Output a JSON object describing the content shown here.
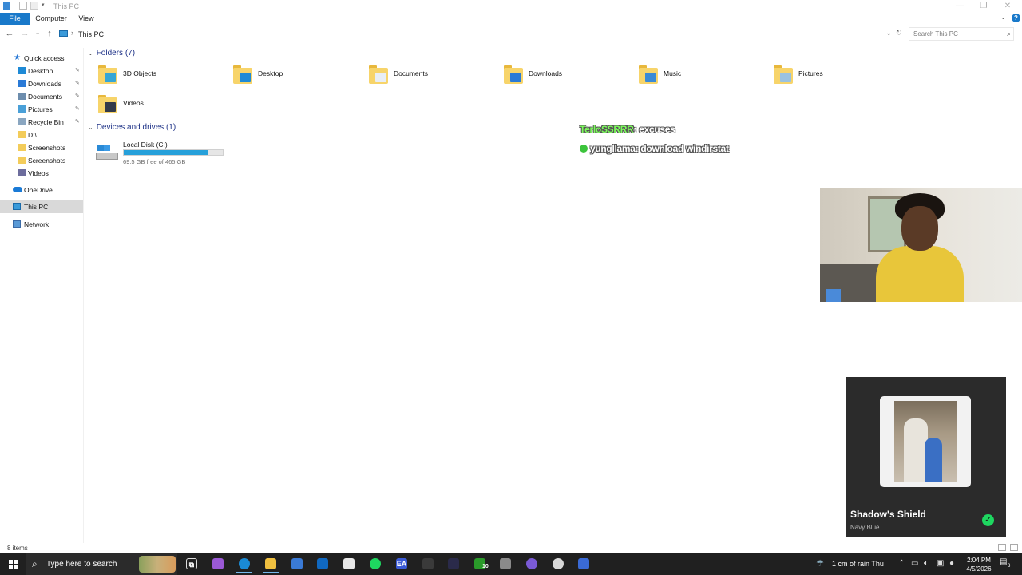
{
  "window": {
    "title": "This PC",
    "minimize": "—",
    "maximize": "❐",
    "close": "✕"
  },
  "ribbon": {
    "tabs": [
      "File",
      "Computer",
      "View"
    ]
  },
  "address": {
    "crumb": "This PC",
    "separator": "›"
  },
  "search": {
    "placeholder": "Search This PC"
  },
  "nav": {
    "quick_access": "Quick access",
    "items": [
      {
        "label": "Desktop",
        "pinned": true,
        "icon": "desktop-icon",
        "color": "#1e8ad6"
      },
      {
        "label": "Downloads",
        "pinned": true,
        "icon": "download-icon",
        "color": "#2a7ad6"
      },
      {
        "label": "Documents",
        "pinned": true,
        "icon": "documents-icon",
        "color": "#6d8dad"
      },
      {
        "label": "Pictures",
        "pinned": true,
        "icon": "pictures-icon",
        "color": "#4aa0d8"
      },
      {
        "label": "Recycle Bin",
        "pinned": true,
        "icon": "recycle-bin-icon",
        "color": "#8aa6c0"
      },
      {
        "label": "D:\\",
        "pinned": false,
        "icon": "folder-icon",
        "color": "#f3cc5a"
      },
      {
        "label": "Screenshots",
        "pinned": false,
        "icon": "folder-icon",
        "color": "#f3cc5a"
      },
      {
        "label": "Screenshots",
        "pinned": false,
        "icon": "folder-icon",
        "color": "#f3cc5a"
      },
      {
        "label": "Videos",
        "pinned": false,
        "icon": "videos-icon",
        "color": "#6d6d9d"
      }
    ],
    "onedrive": "OneDrive",
    "this_pc": "This PC",
    "network": "Network"
  },
  "content": {
    "folders_header": "Folders (7)",
    "folders": [
      {
        "name": "3D Objects",
        "icon": "3d-objects-icon",
        "overlay": "#35a6d6"
      },
      {
        "name": "Desktop",
        "icon": "desktop-folder-icon",
        "overlay": "#1e8ad6"
      },
      {
        "name": "Documents",
        "icon": "documents-folder-icon",
        "overlay": "#e8eef5"
      },
      {
        "name": "Downloads",
        "icon": "downloads-folder-icon",
        "overlay": "#2a7ad6"
      },
      {
        "name": "Music",
        "icon": "music-folder-icon",
        "overlay": "#3a8ad6"
      },
      {
        "name": "Pictures",
        "icon": "pictures-folder-icon",
        "overlay": "#9ac2e0"
      },
      {
        "name": "Videos",
        "icon": "videos-folder-icon",
        "overlay": "#333a4a"
      }
    ],
    "drives_header": "Devices and drives (1)",
    "drives": [
      {
        "name": "Local Disk (C:)",
        "free_text": "69.5 GB free of 465 GB",
        "used_fraction": 0.85
      }
    ]
  },
  "chat": [
    {
      "user": "TerloSSRRR",
      "message": ": excuses"
    },
    {
      "user": "yungllama",
      "message": ": download windirstat"
    }
  ],
  "now_playing": {
    "title": "Shadow's Shield",
    "artist": "Navy Blue",
    "check": "✓"
  },
  "status": {
    "items": "8 items"
  },
  "taskbar": {
    "search_text": "Type here to search",
    "weather": "1 cm of rain Thu",
    "time": "2:04 PM",
    "date": "4/5/2026",
    "notification_count": "3",
    "apps": [
      {
        "icon": "task-view-icon",
        "color": "#202020",
        "glyph": "⧉"
      },
      {
        "icon": "copilot-icon",
        "color": "#9b59d6",
        "glyph": ""
      },
      {
        "icon": "edge-icon",
        "color": "#1a8ad4",
        "glyph": ""
      },
      {
        "icon": "file-explorer-icon",
        "color": "#f0c040",
        "glyph": ""
      },
      {
        "icon": "store-icon",
        "color": "#3a7ad6",
        "glyph": ""
      },
      {
        "icon": "outlook-icon",
        "color": "#1068c0",
        "glyph": ""
      },
      {
        "icon": "notepad-icon",
        "color": "#e8e8e8",
        "glyph": ""
      },
      {
        "icon": "spotify-icon",
        "color": "#1ed760",
        "glyph": ""
      },
      {
        "icon": "ea-icon",
        "color": "#3a5ad6",
        "glyph": "EA"
      },
      {
        "icon": "obs-icon",
        "color": "#3a3a3a",
        "glyph": ""
      },
      {
        "icon": "cursor-app-icon",
        "color": "#2a2a4a",
        "glyph": ""
      },
      {
        "icon": "xbox-icon",
        "color": "#2a9a2a",
        "glyph": ""
      },
      {
        "icon": "steam-icon",
        "color": "#8a8a8a",
        "glyph": ""
      },
      {
        "icon": "discord-icon",
        "color": "#7a5ad6",
        "glyph": ""
      },
      {
        "icon": "chrome-icon",
        "color": "#d8d8d8",
        "glyph": ""
      },
      {
        "icon": "vpn-icon",
        "color": "#3a6ad6",
        "glyph": ""
      }
    ],
    "xbox_badge": "10"
  }
}
